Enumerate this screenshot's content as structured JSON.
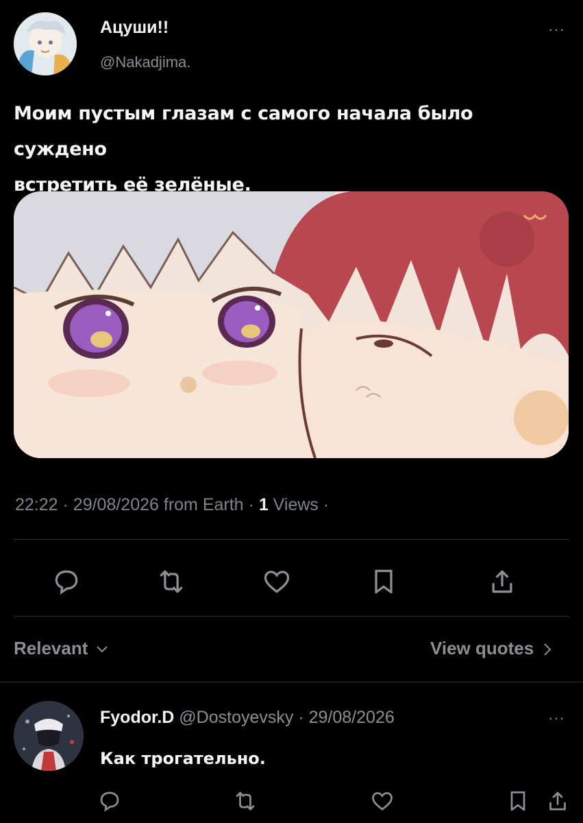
{
  "post": {
    "author_name": "Ацуши!!",
    "author_handle": "@Nakadjima.",
    "more_label": "···",
    "text_line1": "Моим пустым глазам с самого начала было суждено",
    "text_line2": "встретить её зелёные.",
    "time": "22:22",
    "date": "29/08/2026",
    "source": "from Earth",
    "views_count": "1",
    "views_label": "Views"
  },
  "actions": {
    "icons": [
      "reply-icon",
      "retweet-icon",
      "like-icon",
      "bookmark-icon",
      "share-icon"
    ]
  },
  "sort": {
    "label": "Relevant",
    "view_quotes": "View quotes"
  },
  "reply": {
    "author_name": "Fyodor.D",
    "author_handle": "@Dostoyevsky",
    "date": "29/08/2026",
    "more_label": "···",
    "text": "Как трогательно."
  },
  "colors": {
    "background": "#000000",
    "text": "#e7e9ea",
    "muted": "#8b8f95",
    "divider": "#2f3336"
  }
}
